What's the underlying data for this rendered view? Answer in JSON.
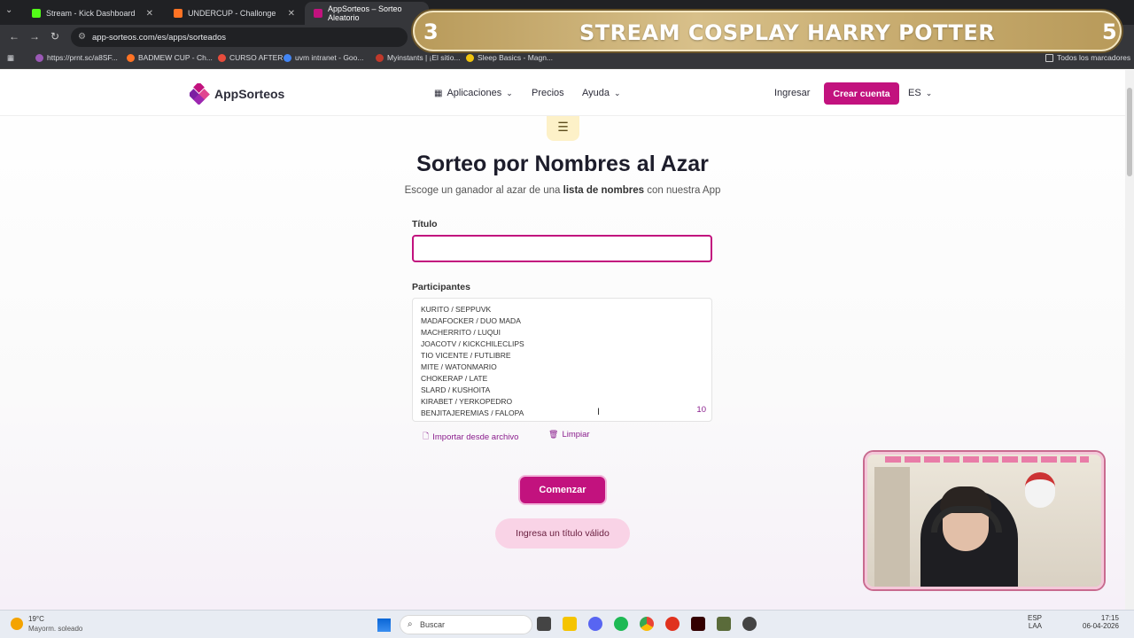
{
  "browser": {
    "tabs": [
      {
        "label": "Stream - Kick Dashboard",
        "color": "#53fc18"
      },
      {
        "label": "UNDERCUP - Challonge",
        "color": "#ff7324"
      },
      {
        "label": "AppSorteos – Sorteo Aleatorio",
        "color": "#c2127e"
      }
    ],
    "url": "app-sorteos.com/es/apps/sorteados",
    "bookmarks": [
      "https://prnt.sc/a8SF...",
      "BADMEW CUP - Ch...",
      "CURSO AFTER",
      "uvm intranet - Goo...",
      "Myinstants | ¡El sitio...",
      "Sleep Basics - Magn...",
      "Todos los marcadores"
    ]
  },
  "overlay": {
    "left_number": "3",
    "text": "STREAM COSPLAY HARRY POTTER",
    "right_number": "5"
  },
  "site": {
    "logo": "AppSorteos",
    "nav": {
      "apps": "Aplicaciones",
      "prices": "Precios",
      "help": "Ayuda",
      "login": "Ingresar",
      "signup": "Crear cuenta",
      "lang": "ES"
    },
    "title": "Sorteo por Nombres al Azar",
    "subtitle_pre": "Escoge un ganador al azar de una ",
    "subtitle_bold": "lista de nombres",
    "subtitle_post": " con nuestra App",
    "form": {
      "title_label": "Título",
      "title_value": "",
      "participants_label": "Participantes",
      "participants": [
        "KURITO / SEPPUVK",
        "MADAFOCKER / DUO MADA",
        "MACHERRITO / LUQUI",
        "JOACOTV / KICKCHILECLIPS",
        "TIO VICENTE / FUTLIBRE",
        "MITE / WATONMARIO",
        "CHOKERAP / LATE",
        "SLARD / KUSHOITA",
        "KIRABET / YERKOPEDRO",
        "BENJITAJEREMIAS / FALOPA"
      ],
      "count": "10",
      "import_label": "Importar desde archivo",
      "clear_label": "Limpiar",
      "start_label": "Comenzar",
      "warning": "Ingresa un título válido"
    }
  },
  "taskbar": {
    "temp": "19°C",
    "weather": "Mayorm. soleado",
    "search": "Buscar",
    "lang_top": "ESP",
    "lang_bottom": "LAA",
    "time": "17:15",
    "date": "06-04-2026"
  },
  "colors": {
    "accent": "#c2127e",
    "accent_light": "#f9d3e6"
  }
}
